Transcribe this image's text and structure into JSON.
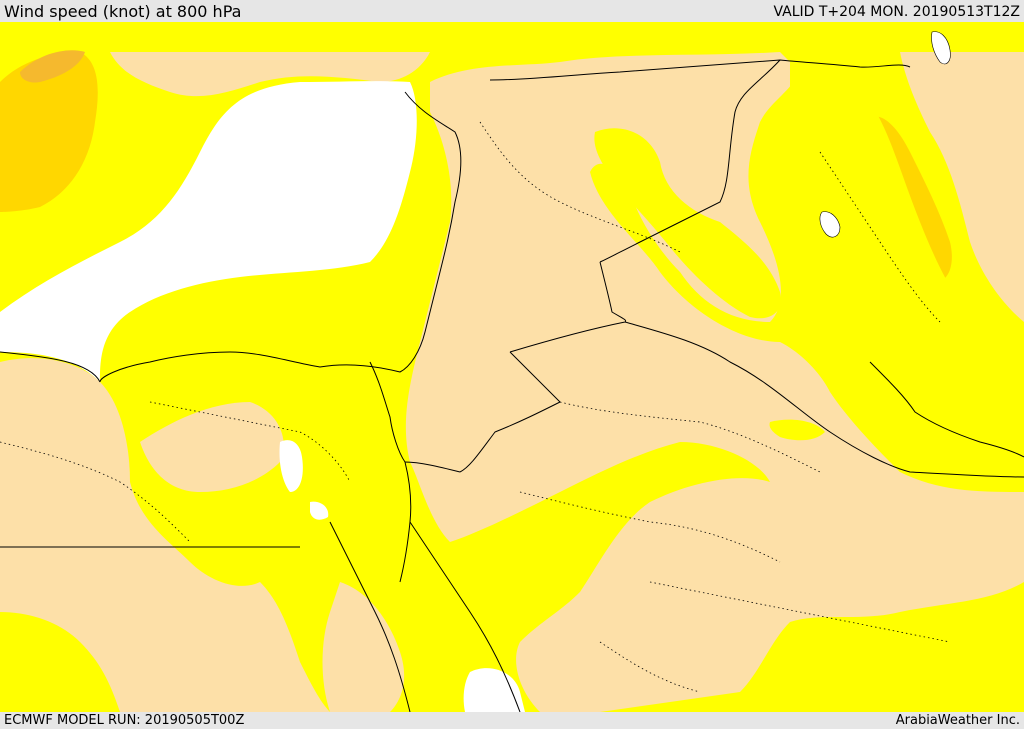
{
  "header": {
    "title": "Wind speed (knot) at 800 hPa",
    "valid": "VALID T+204 MON. 20190513T12Z"
  },
  "footer": {
    "model_run": "ECMWF MODEL RUN: 20190505T00Z",
    "credit": "ArabiaWeather Inc."
  },
  "map": {
    "colors": {
      "calm_white": "#ffffff",
      "light_tan": "#fde0a8",
      "yellow": "#ffff00",
      "gold": "#ffd700",
      "orange": "#f5b92e",
      "border_line": "#000000"
    }
  }
}
